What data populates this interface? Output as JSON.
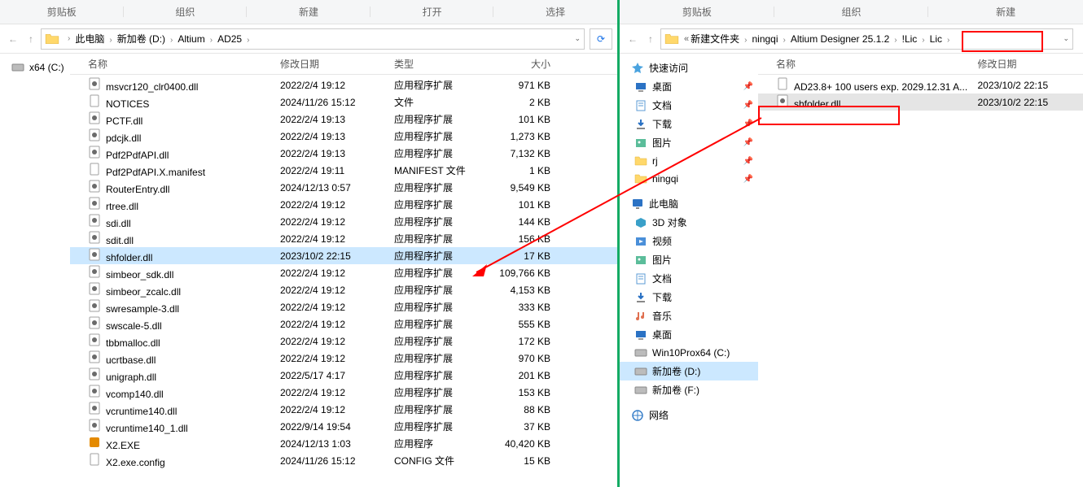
{
  "left": {
    "ribbon": [
      "剪贴板",
      "组织",
      "新建",
      "打开",
      "选择"
    ],
    "breadcrumbs": [
      "此电脑",
      "新加卷 (D:)",
      "Altium",
      "AD25"
    ],
    "nav": [
      {
        "label": "x64 (C:)",
        "icon": "disk"
      }
    ],
    "headers": {
      "name": "名称",
      "date": "修改日期",
      "type": "类型",
      "size": "大小"
    },
    "files": [
      {
        "name": "msvcr120_clr0400.dll",
        "date": "2022/2/4 19:12",
        "type": "应用程序扩展",
        "size": "971 KB",
        "icon": "dll"
      },
      {
        "name": "NOTICES",
        "date": "2024/11/26 15:12",
        "type": "文件",
        "size": "2 KB",
        "icon": "file"
      },
      {
        "name": "PCTF.dll",
        "date": "2022/2/4 19:13",
        "type": "应用程序扩展",
        "size": "101 KB",
        "icon": "dll"
      },
      {
        "name": "pdcjk.dll",
        "date": "2022/2/4 19:13",
        "type": "应用程序扩展",
        "size": "1,273 KB",
        "icon": "dll"
      },
      {
        "name": "Pdf2PdfAPI.dll",
        "date": "2022/2/4 19:13",
        "type": "应用程序扩展",
        "size": "7,132 KB",
        "icon": "dll"
      },
      {
        "name": "Pdf2PdfAPI.X.manifest",
        "date": "2022/2/4 19:11",
        "type": "MANIFEST 文件",
        "size": "1 KB",
        "icon": "file"
      },
      {
        "name": "RouterEntry.dll",
        "date": "2024/12/13 0:57",
        "type": "应用程序扩展",
        "size": "9,549 KB",
        "icon": "dll"
      },
      {
        "name": "rtree.dll",
        "date": "2022/2/4 19:12",
        "type": "应用程序扩展",
        "size": "101 KB",
        "icon": "dll"
      },
      {
        "name": "sdi.dll",
        "date": "2022/2/4 19:12",
        "type": "应用程序扩展",
        "size": "144 KB",
        "icon": "dll"
      },
      {
        "name": "sdit.dll",
        "date": "2022/2/4 19:12",
        "type": "应用程序扩展",
        "size": "156 KB",
        "icon": "dll"
      },
      {
        "name": "shfolder.dll",
        "date": "2023/10/2 22:15",
        "type": "应用程序扩展",
        "size": "17 KB",
        "icon": "dll",
        "selected": true
      },
      {
        "name": "simbeor_sdk.dll",
        "date": "2022/2/4 19:12",
        "type": "应用程序扩展",
        "size": "109,766 KB",
        "icon": "dll"
      },
      {
        "name": "simbeor_zcalc.dll",
        "date": "2022/2/4 19:12",
        "type": "应用程序扩展",
        "size": "4,153 KB",
        "icon": "dll"
      },
      {
        "name": "swresample-3.dll",
        "date": "2022/2/4 19:12",
        "type": "应用程序扩展",
        "size": "333 KB",
        "icon": "dll"
      },
      {
        "name": "swscale-5.dll",
        "date": "2022/2/4 19:12",
        "type": "应用程序扩展",
        "size": "555 KB",
        "icon": "dll"
      },
      {
        "name": "tbbmalloc.dll",
        "date": "2022/2/4 19:12",
        "type": "应用程序扩展",
        "size": "172 KB",
        "icon": "dll"
      },
      {
        "name": "ucrtbase.dll",
        "date": "2022/2/4 19:12",
        "type": "应用程序扩展",
        "size": "970 KB",
        "icon": "dll"
      },
      {
        "name": "unigraph.dll",
        "date": "2022/5/17 4:17",
        "type": "应用程序扩展",
        "size": "201 KB",
        "icon": "dll"
      },
      {
        "name": "vcomp140.dll",
        "date": "2022/2/4 19:12",
        "type": "应用程序扩展",
        "size": "153 KB",
        "icon": "dll"
      },
      {
        "name": "vcruntime140.dll",
        "date": "2022/2/4 19:12",
        "type": "应用程序扩展",
        "size": "88 KB",
        "icon": "dll"
      },
      {
        "name": "vcruntime140_1.dll",
        "date": "2022/9/14 19:54",
        "type": "应用程序扩展",
        "size": "37 KB",
        "icon": "dll"
      },
      {
        "name": "X2.EXE",
        "date": "2024/12/13 1:03",
        "type": "应用程序",
        "size": "40,420 KB",
        "icon": "exe"
      },
      {
        "name": "X2.exe.config",
        "date": "2024/11/26 15:12",
        "type": "CONFIG 文件",
        "size": "15 KB",
        "icon": "file"
      }
    ]
  },
  "right": {
    "ribbon": [
      "剪贴板",
      "组织",
      "新建"
    ],
    "breadcrumbs_prefix": "«",
    "breadcrumbs": [
      "新建文件夹",
      "ningqi",
      "Altium Designer 25.1.2",
      "!Lic",
      "Lic"
    ],
    "nav_quick_title": "快速访问",
    "nav_quick": [
      {
        "label": "桌面",
        "icon": "desktop",
        "pin": true
      },
      {
        "label": "文档",
        "icon": "docs",
        "pin": true
      },
      {
        "label": "下载",
        "icon": "download",
        "pin": true
      },
      {
        "label": "图片",
        "icon": "pictures",
        "pin": true
      },
      {
        "label": "rj",
        "icon": "folder",
        "pin": true
      },
      {
        "label": "ningqi",
        "icon": "folder",
        "pin": true
      }
    ],
    "nav_pc_title": "此电脑",
    "nav_pc": [
      {
        "label": "3D 对象",
        "icon": "3d"
      },
      {
        "label": "视频",
        "icon": "video"
      },
      {
        "label": "图片",
        "icon": "pictures"
      },
      {
        "label": "文档",
        "icon": "docs"
      },
      {
        "label": "下载",
        "icon": "download"
      },
      {
        "label": "音乐",
        "icon": "music"
      },
      {
        "label": "桌面",
        "icon": "desktop"
      },
      {
        "label": "Win10Prox64 (C:)",
        "icon": "disk"
      },
      {
        "label": "新加卷 (D:)",
        "icon": "disk",
        "selected": true
      },
      {
        "label": "新加卷 (F:)",
        "icon": "disk"
      }
    ],
    "nav_net_title": "网络",
    "headers": {
      "name": "名称",
      "date": "修改日期"
    },
    "files": [
      {
        "name": "AD23.8+ 100 users exp. 2029.12.31 A...",
        "date": "2023/10/2 22:15",
        "icon": "file"
      },
      {
        "name": "shfolder.dll",
        "date": "2023/10/2 22:15",
        "icon": "dll",
        "rsel": true,
        "highlight": true
      }
    ]
  }
}
